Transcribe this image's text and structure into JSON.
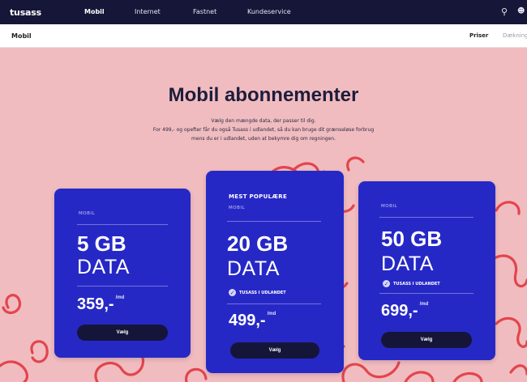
{
  "nav": {
    "logo": "tusass",
    "links": [
      "Mobil",
      "Internet",
      "Fastnet",
      "Kundeservice"
    ],
    "active": 0
  },
  "subnav": {
    "title": "Mobil",
    "links": [
      "Priser",
      "Dækning"
    ]
  },
  "hero": {
    "title": "Mobil abonnementer",
    "lines": [
      "Vælg den mængde data, der passer til dig.",
      "For 499,- og opefter får du også Tusass i udlandet, så du kan bruge dit grænseløse forbrug",
      "mens du er i udlandet, uden at bekymre dig om regningen."
    ]
  },
  "plans": [
    {
      "featured_label": "",
      "tag": "MOBIL",
      "gb": "5 GB",
      "data": "DATA",
      "perk": "",
      "price": "359,-",
      "price_suffix": "/md",
      "button": "Vælg"
    },
    {
      "featured_label": "MEST POPULÆRE",
      "tag": "MOBIL",
      "gb": "20 GB",
      "data": "DATA",
      "perk": "TUSASS I UDLANDET",
      "price": "499,-",
      "price_suffix": "/md",
      "button": "Vælg"
    },
    {
      "featured_label": "",
      "tag": "MOBIL",
      "gb": "50 GB",
      "data": "DATA",
      "perk": "TUSASS I UDLANDET",
      "price": "699,-",
      "price_suffix": "/md",
      "button": "Vælg"
    }
  ],
  "colors": {
    "nav_bg": "#161638",
    "page_bg": "#f1bcbf",
    "card_bg": "#2628c6",
    "button_bg": "#15153a",
    "pattern": "#e2454e"
  }
}
